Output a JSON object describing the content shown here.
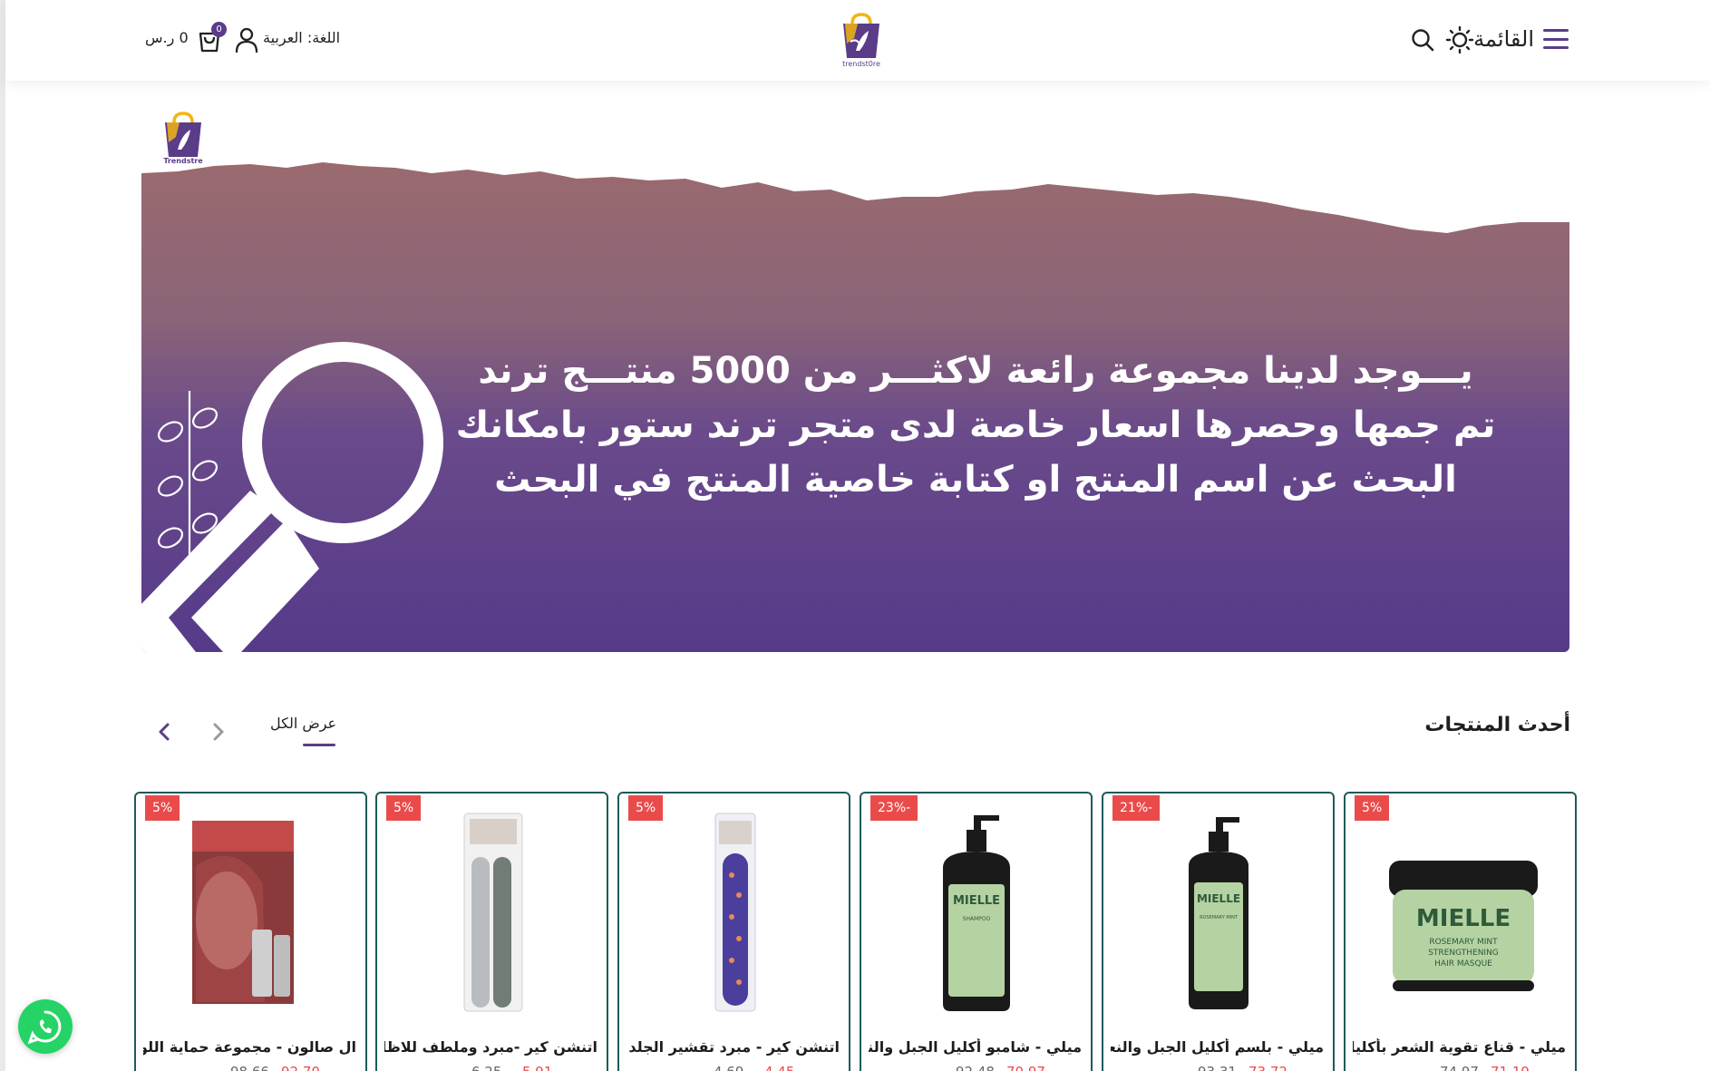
{
  "header": {
    "menu_label": "القائمة",
    "language_label": "اللغة: العربية",
    "cart_count": "0",
    "cart_total": "0 ر.س",
    "logo_text": "trendst0re"
  },
  "banner": {
    "logo_text": "Trendstre",
    "lines": [
      "يـــوجد لدينا مجموعة رائعة لاكثـــر من 5000 منتـــج ترند",
      "تم جمها وحصرها  اسعار خاصة لدى متجر ترند ستور بامكانك",
      "البحث عن اسم المنتج او كتابة خاصية المنتج في البحث"
    ]
  },
  "section": {
    "title": "أحدث المنتجات",
    "view_all": "عرض الكل"
  },
  "products": [
    {
      "name": "ميلي - قناع تقوية الشعر بأكليل الجبل",
      "discount": "5%",
      "price_new": "71.19",
      "price_old": "74.97"
    },
    {
      "name": "ميلي - بلسم أكليل الجبل والنعناع",
      "discount": "21%-",
      "price_new": "73.72",
      "price_old": "93.31"
    },
    {
      "name": "ميلي - شامبو أكليل الجبل والنعناع",
      "discount": "23%-",
      "price_new": "70.97",
      "price_old": "92.48"
    },
    {
      "name": "اتنشن كير - مبرد تقشير الجلد الميت",
      "discount": "5%",
      "price_new": "4.45",
      "price_old": "4.69"
    },
    {
      "name": "اتنشن كير -مبرد وملطف للاظافر",
      "discount": "5%",
      "price_new": "5.91",
      "price_old": "6.25"
    },
    {
      "name": "ال صالون - مجموعة حماية اللون",
      "discount": "5%",
      "price_new": "92.70",
      "price_old": "98.66"
    }
  ],
  "colors": {
    "brand": "#5b3c88",
    "discount": "#e94b4b",
    "card_border": "#1f5a5a",
    "whatsapp": "#25d366"
  }
}
